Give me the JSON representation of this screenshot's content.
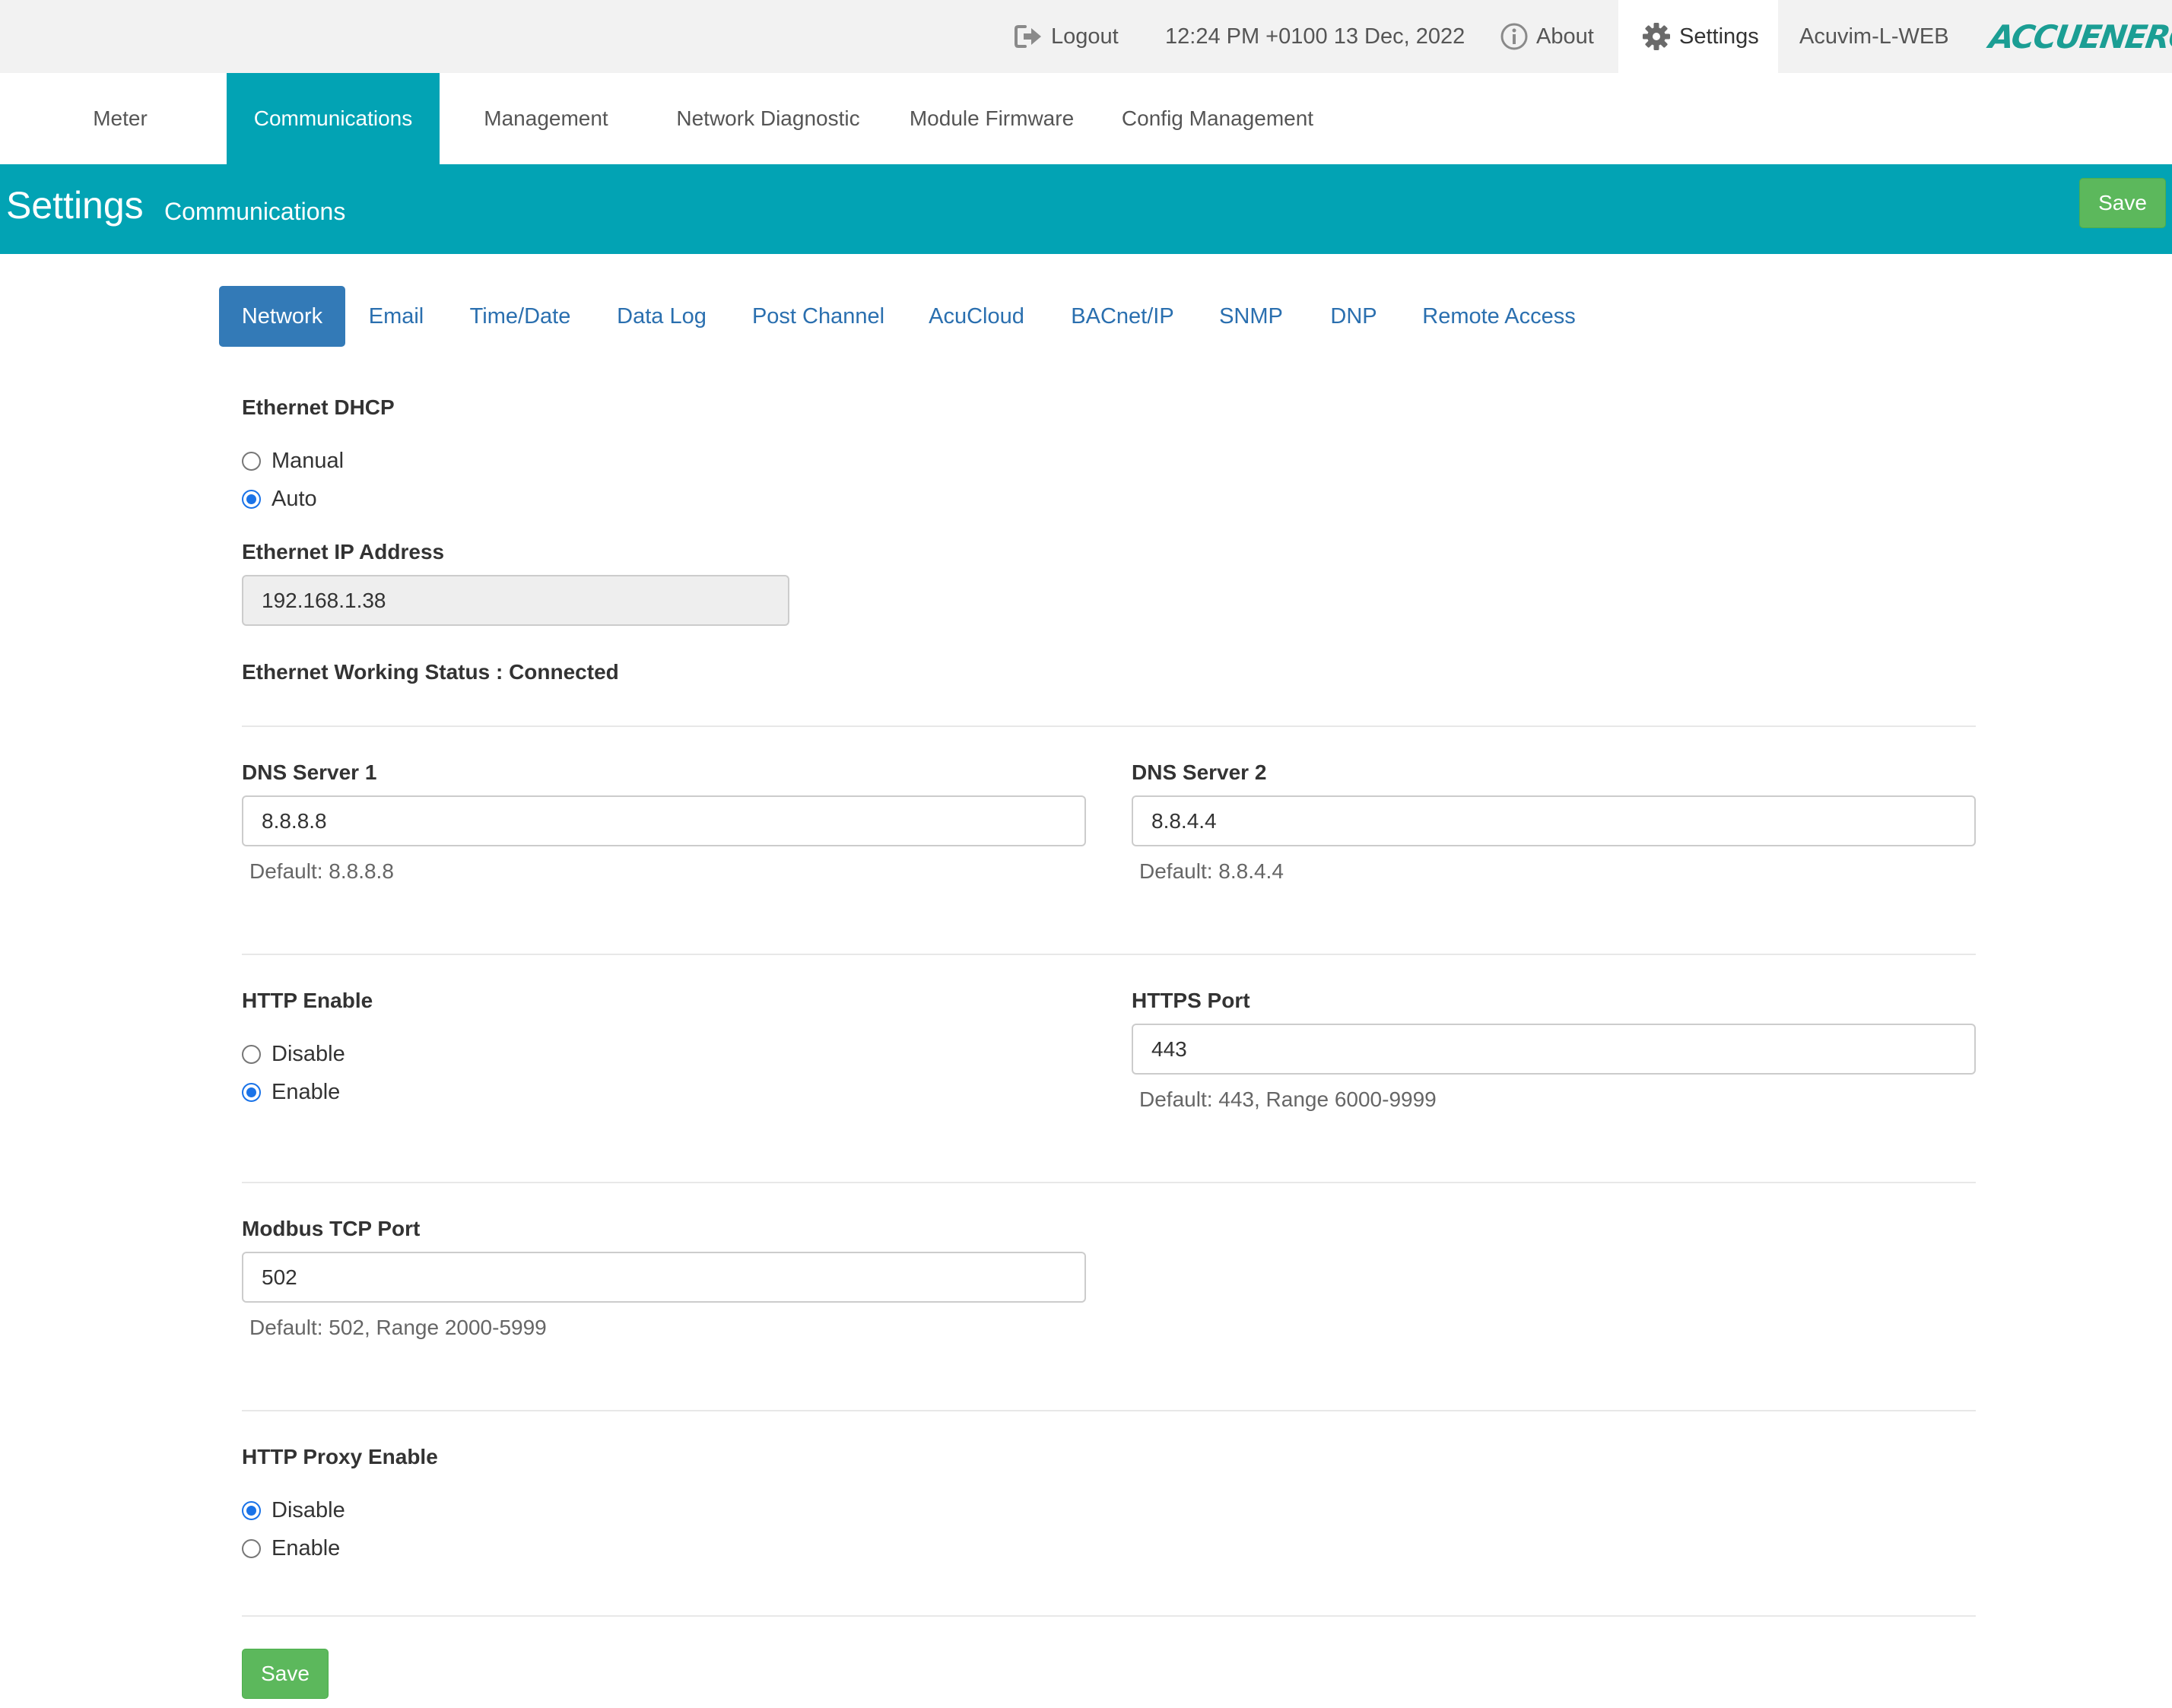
{
  "topbar": {
    "logout_label": "Logout",
    "datetime": "12:24 PM +0100 13 Dec, 2022",
    "about_label": "About",
    "settings_label": "Settings",
    "device_name": "Acuvim-L-WEB",
    "logo_text": "ACCUENERGY"
  },
  "nav": {
    "items": [
      {
        "label": "Meter"
      },
      {
        "label": "Communications"
      },
      {
        "label": "Management"
      },
      {
        "label": "Network Diagnostic"
      },
      {
        "label": "Module Firmware"
      },
      {
        "label": "Config Management"
      }
    ],
    "active": "Communications"
  },
  "header": {
    "title": "Settings",
    "subtitle": "Communications",
    "save_label": "Save"
  },
  "subtabs": {
    "items": [
      {
        "label": "Network"
      },
      {
        "label": "Email"
      },
      {
        "label": "Time/Date"
      },
      {
        "label": "Data Log"
      },
      {
        "label": "Post Channel"
      },
      {
        "label": "AcuCloud"
      },
      {
        "label": "BACnet/IP"
      },
      {
        "label": "SNMP"
      },
      {
        "label": "DNP"
      },
      {
        "label": "Remote Access"
      }
    ],
    "active": "Network"
  },
  "form": {
    "dhcp": {
      "label": "Ethernet DHCP",
      "options": [
        {
          "label": "Manual"
        },
        {
          "label": "Auto"
        }
      ],
      "selected": "Auto"
    },
    "ip": {
      "label": "Ethernet IP Address",
      "value": "192.168.1.38"
    },
    "status": {
      "text": "Ethernet Working Status : Connected"
    },
    "dns1": {
      "label": "DNS Server 1",
      "value": "8.8.8.8",
      "help": "Default: 8.8.8.8"
    },
    "dns2": {
      "label": "DNS Server 2",
      "value": "8.8.4.4",
      "help": "Default: 8.8.4.4"
    },
    "http_enable": {
      "label": "HTTP Enable",
      "options": [
        {
          "label": "Disable"
        },
        {
          "label": "Enable"
        }
      ],
      "selected": "Enable"
    },
    "https_port": {
      "label": "HTTPS Port",
      "value": "443",
      "help": "Default: 443, Range 6000-9999"
    },
    "modbus_port": {
      "label": "Modbus TCP Port",
      "value": "502",
      "help": "Default: 502, Range 2000-5999"
    },
    "proxy": {
      "label": "HTTP Proxy Enable",
      "options": [
        {
          "label": "Disable"
        },
        {
          "label": "Enable"
        }
      ],
      "selected": "Disable"
    },
    "save_label": "Save"
  },
  "colors": {
    "teal": "#02a3b4",
    "save_green": "#5cb85c",
    "tab_blue": "#337ab7",
    "link_blue": "#2a6faf",
    "radio_blue": "#1a73e8",
    "logo_teal": "#1b9e94"
  }
}
